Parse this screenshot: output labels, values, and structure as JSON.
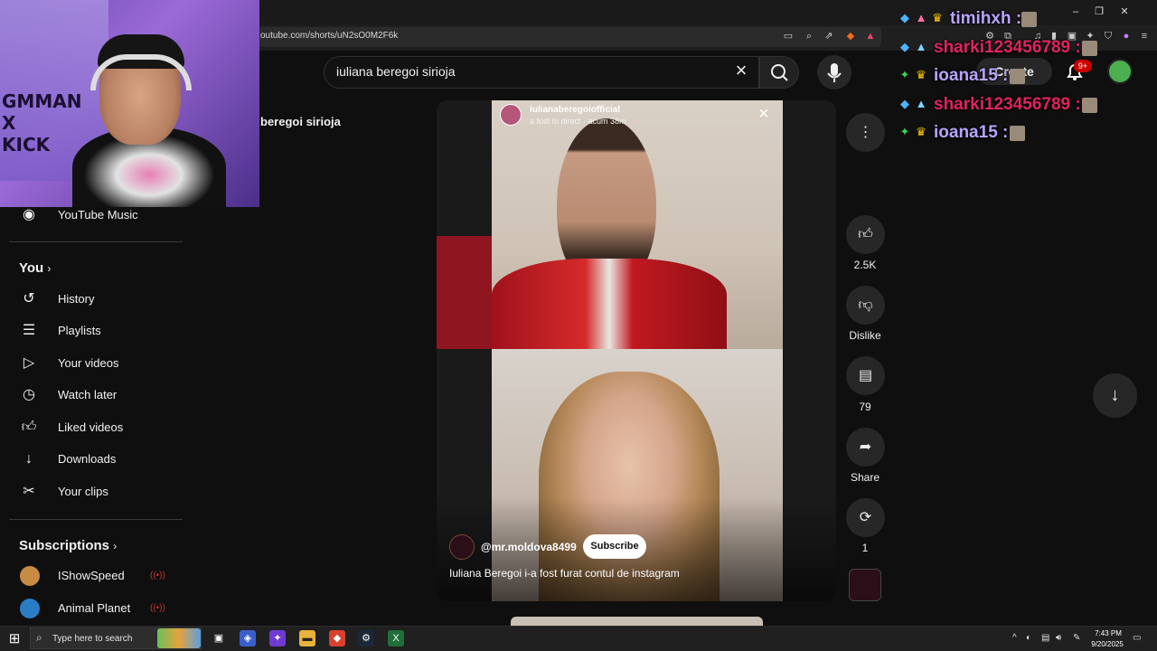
{
  "browser": {
    "url": "outube.com/shorts/uN2sO0M2F6k"
  },
  "youtube": {
    "search_query": "iuliana beregoi sirioja",
    "query_label": "beregoi sirioja",
    "create_label": "Create",
    "notification_count": "9+"
  },
  "sidebar": {
    "music_label": "YouTube Music",
    "you_heading": "You",
    "items": [
      {
        "label": "History"
      },
      {
        "label": "Playlists"
      },
      {
        "label": "Your videos"
      },
      {
        "label": "Watch later"
      },
      {
        "label": "Liked videos"
      },
      {
        "label": "Downloads"
      },
      {
        "label": "Your clips"
      }
    ],
    "subscriptions_heading": "Subscriptions",
    "subscriptions": [
      {
        "label": "IShowSpeed"
      },
      {
        "label": "Animal Planet"
      }
    ]
  },
  "short": {
    "overlay_account": "iulianaberegoiofficial",
    "overlay_status": "a fost în direct · acum 38m",
    "channel": "@mr.moldova8499",
    "subscribe_label": "Subscribe",
    "title": "Iuliana Beregoi i-a fost furat contul de instagram",
    "likes": "2.5K",
    "dislike_label": "Dislike",
    "comments": "79",
    "share_label": "Share",
    "remix_count": "1"
  },
  "chat": [
    {
      "user": "timihxh",
      "color": "#b9a4ff"
    },
    {
      "user": "sharki123456789",
      "color": "#e0245e"
    },
    {
      "user": "ioana15",
      "color": "#b9a4ff"
    },
    {
      "user": "sharki123456789",
      "color": "#e0245e"
    },
    {
      "user": "ioana15",
      "color": "#b9a4ff"
    }
  ],
  "chat_separator": ":",
  "webcam": {
    "poster_text": "GMMAN\nX\nKICK"
  },
  "taskbar": {
    "search_placeholder": "Type here to search",
    "time": "7:43 PM",
    "date": "9/20/2025"
  }
}
